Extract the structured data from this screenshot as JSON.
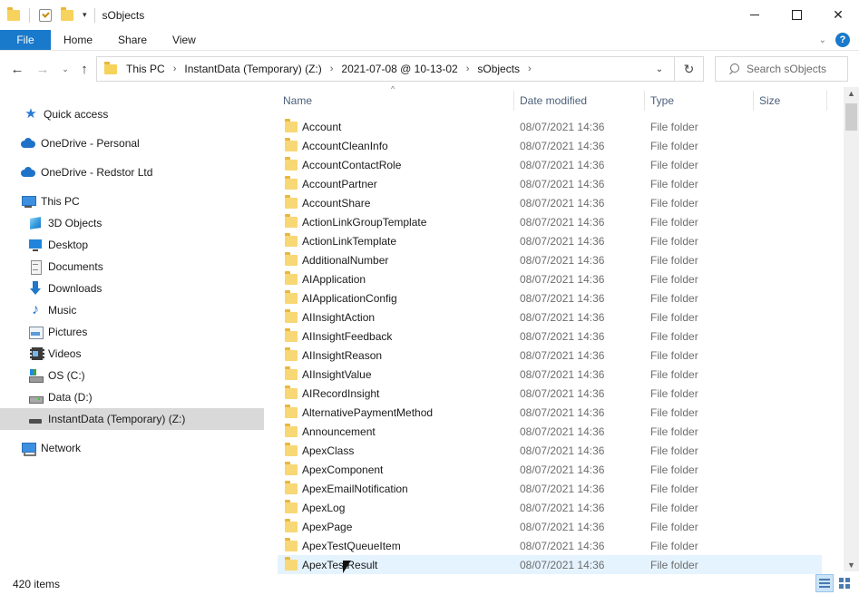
{
  "window": {
    "title": "sObjects",
    "controls": {
      "minimize": "",
      "maximize": "",
      "close": "✕"
    }
  },
  "ribbon": {
    "tabs": [
      "File",
      "Home",
      "Share",
      "View"
    ],
    "help": "?",
    "collapse": "⌄"
  },
  "address": {
    "crumbs": [
      "This PC",
      "InstantData (Temporary) (Z:)",
      "2021-07-08 @ 10-13-02",
      "sObjects"
    ],
    "separator": "›",
    "dropdown": "⌄",
    "refresh": "↻"
  },
  "search": {
    "placeholder": "Search sObjects"
  },
  "nav": {
    "back": "←",
    "forward": "→",
    "recent": "⌄",
    "up": "↑"
  },
  "sidebar": {
    "items": [
      {
        "label": "Quick access",
        "icon": "star-icon"
      },
      {
        "label": "OneDrive - Personal",
        "icon": "cloud-icon"
      },
      {
        "label": "OneDrive - Redstor Ltd",
        "icon": "cloud-icon"
      },
      {
        "label": "This PC",
        "icon": "pc-icon"
      },
      {
        "label": "3D Objects",
        "icon": "cube-icon"
      },
      {
        "label": "Desktop",
        "icon": "desktop-icon"
      },
      {
        "label": "Documents",
        "icon": "documents-icon"
      },
      {
        "label": "Downloads",
        "icon": "downloads-icon"
      },
      {
        "label": "Music",
        "icon": "music-icon"
      },
      {
        "label": "Pictures",
        "icon": "pictures-icon"
      },
      {
        "label": "Videos",
        "icon": "videos-icon"
      },
      {
        "label": "OS (C:)",
        "icon": "os-drive-icon"
      },
      {
        "label": "Data (D:)",
        "icon": "drive-icon"
      },
      {
        "label": "InstantData (Temporary) (Z:)",
        "icon": "removable-drive-icon"
      },
      {
        "label": "Network",
        "icon": "network-icon"
      }
    ]
  },
  "columns": {
    "name": "Name",
    "date": "Date modified",
    "type": "Type",
    "size": "Size"
  },
  "files": [
    {
      "name": "Account",
      "date": "08/07/2021 14:36",
      "type": "File folder"
    },
    {
      "name": "AccountCleanInfo",
      "date": "08/07/2021 14:36",
      "type": "File folder"
    },
    {
      "name": "AccountContactRole",
      "date": "08/07/2021 14:36",
      "type": "File folder"
    },
    {
      "name": "AccountPartner",
      "date": "08/07/2021 14:36",
      "type": "File folder"
    },
    {
      "name": "AccountShare",
      "date": "08/07/2021 14:36",
      "type": "File folder"
    },
    {
      "name": "ActionLinkGroupTemplate",
      "date": "08/07/2021 14:36",
      "type": "File folder"
    },
    {
      "name": "ActionLinkTemplate",
      "date": "08/07/2021 14:36",
      "type": "File folder"
    },
    {
      "name": "AdditionalNumber",
      "date": "08/07/2021 14:36",
      "type": "File folder"
    },
    {
      "name": "AIApplication",
      "date": "08/07/2021 14:36",
      "type": "File folder"
    },
    {
      "name": "AIApplicationConfig",
      "date": "08/07/2021 14:36",
      "type": "File folder"
    },
    {
      "name": "AIInsightAction",
      "date": "08/07/2021 14:36",
      "type": "File folder"
    },
    {
      "name": "AIInsightFeedback",
      "date": "08/07/2021 14:36",
      "type": "File folder"
    },
    {
      "name": "AIInsightReason",
      "date": "08/07/2021 14:36",
      "type": "File folder"
    },
    {
      "name": "AIInsightValue",
      "date": "08/07/2021 14:36",
      "type": "File folder"
    },
    {
      "name": "AIRecordInsight",
      "date": "08/07/2021 14:36",
      "type": "File folder"
    },
    {
      "name": "AlternativePaymentMethod",
      "date": "08/07/2021 14:36",
      "type": "File folder"
    },
    {
      "name": "Announcement",
      "date": "08/07/2021 14:36",
      "type": "File folder"
    },
    {
      "name": "ApexClass",
      "date": "08/07/2021 14:36",
      "type": "File folder"
    },
    {
      "name": "ApexComponent",
      "date": "08/07/2021 14:36",
      "type": "File folder"
    },
    {
      "name": "ApexEmailNotification",
      "date": "08/07/2021 14:36",
      "type": "File folder"
    },
    {
      "name": "ApexLog",
      "date": "08/07/2021 14:36",
      "type": "File folder"
    },
    {
      "name": "ApexPage",
      "date": "08/07/2021 14:36",
      "type": "File folder"
    },
    {
      "name": "ApexTestQueueItem",
      "date": "08/07/2021 14:36",
      "type": "File folder"
    },
    {
      "name": "ApexTestResult",
      "date": "08/07/2021 14:36",
      "type": "File folder"
    }
  ],
  "status": {
    "count": "420 items"
  }
}
